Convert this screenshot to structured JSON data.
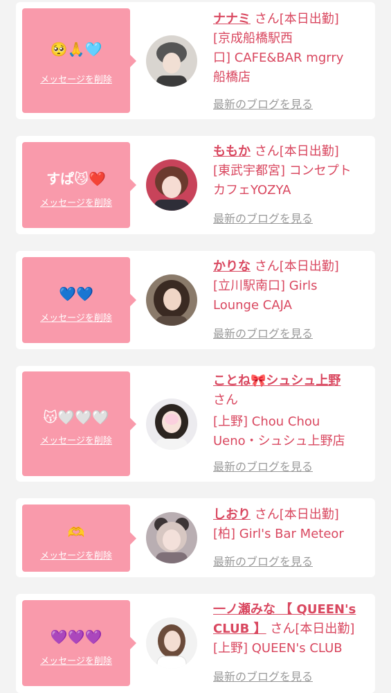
{
  "colors": {
    "page_bg": "#f3f3f3",
    "card_bg": "#ffffff",
    "bubble_bg": "#f99aab",
    "accent_text": "#d9475f",
    "link_gray": "#9a9a9a"
  },
  "common": {
    "delete_label": "メッセージを削除",
    "blog_label": "最新のブログを見る"
  },
  "items": [
    {
      "message": "🥺🙏🩵",
      "name": "ナナミ",
      "honorific_status": "さん[本日出勤]",
      "shop_lines": [
        "[京成船橋駅西",
        "口] CAFE&BAR mgrry",
        "船橋店"
      ],
      "avatar_icon": "avatar-photo-icon"
    },
    {
      "message": "すぱ😼❤️",
      "name": "ももか",
      "honorific_status": "さん[本日出勤]",
      "shop_lines": [
        "[東武宇都宮] コンセプト",
        "カフェYOZYA"
      ],
      "avatar_icon": "avatar-photo-icon"
    },
    {
      "message": "💙💙",
      "name": "かりな",
      "honorific_status": "さん[本日出勤]",
      "shop_lines": [
        "[立川駅南口] Girls",
        "Lounge CAJA"
      ],
      "avatar_icon": "avatar-photo-icon"
    },
    {
      "message": "😽🤍🤍🤍",
      "name": "ことね🎀シュシュ上野",
      "honorific_status": "さん",
      "shop_lines": [
        "[上野] Chou Chou",
        "Ueno・シュシュ上野店"
      ],
      "avatar_icon": "avatar-photo-icon"
    },
    {
      "message": "🫶",
      "name": "しおり",
      "honorific_status": "さん[本日出勤]",
      "shop_lines": [
        "[柏] Girl's Bar Meteor"
      ],
      "avatar_icon": "avatar-photo-icon"
    },
    {
      "message": "💜💜💜",
      "name": "一ノ瀬みな 【 QUEEN's",
      "name_line2": "CLUB 】",
      "honorific_status": "さん[本日出勤]",
      "shop_lines": [
        "[上野] QUEEN's CLUB"
      ],
      "avatar_icon": "avatar-photo-icon"
    }
  ]
}
